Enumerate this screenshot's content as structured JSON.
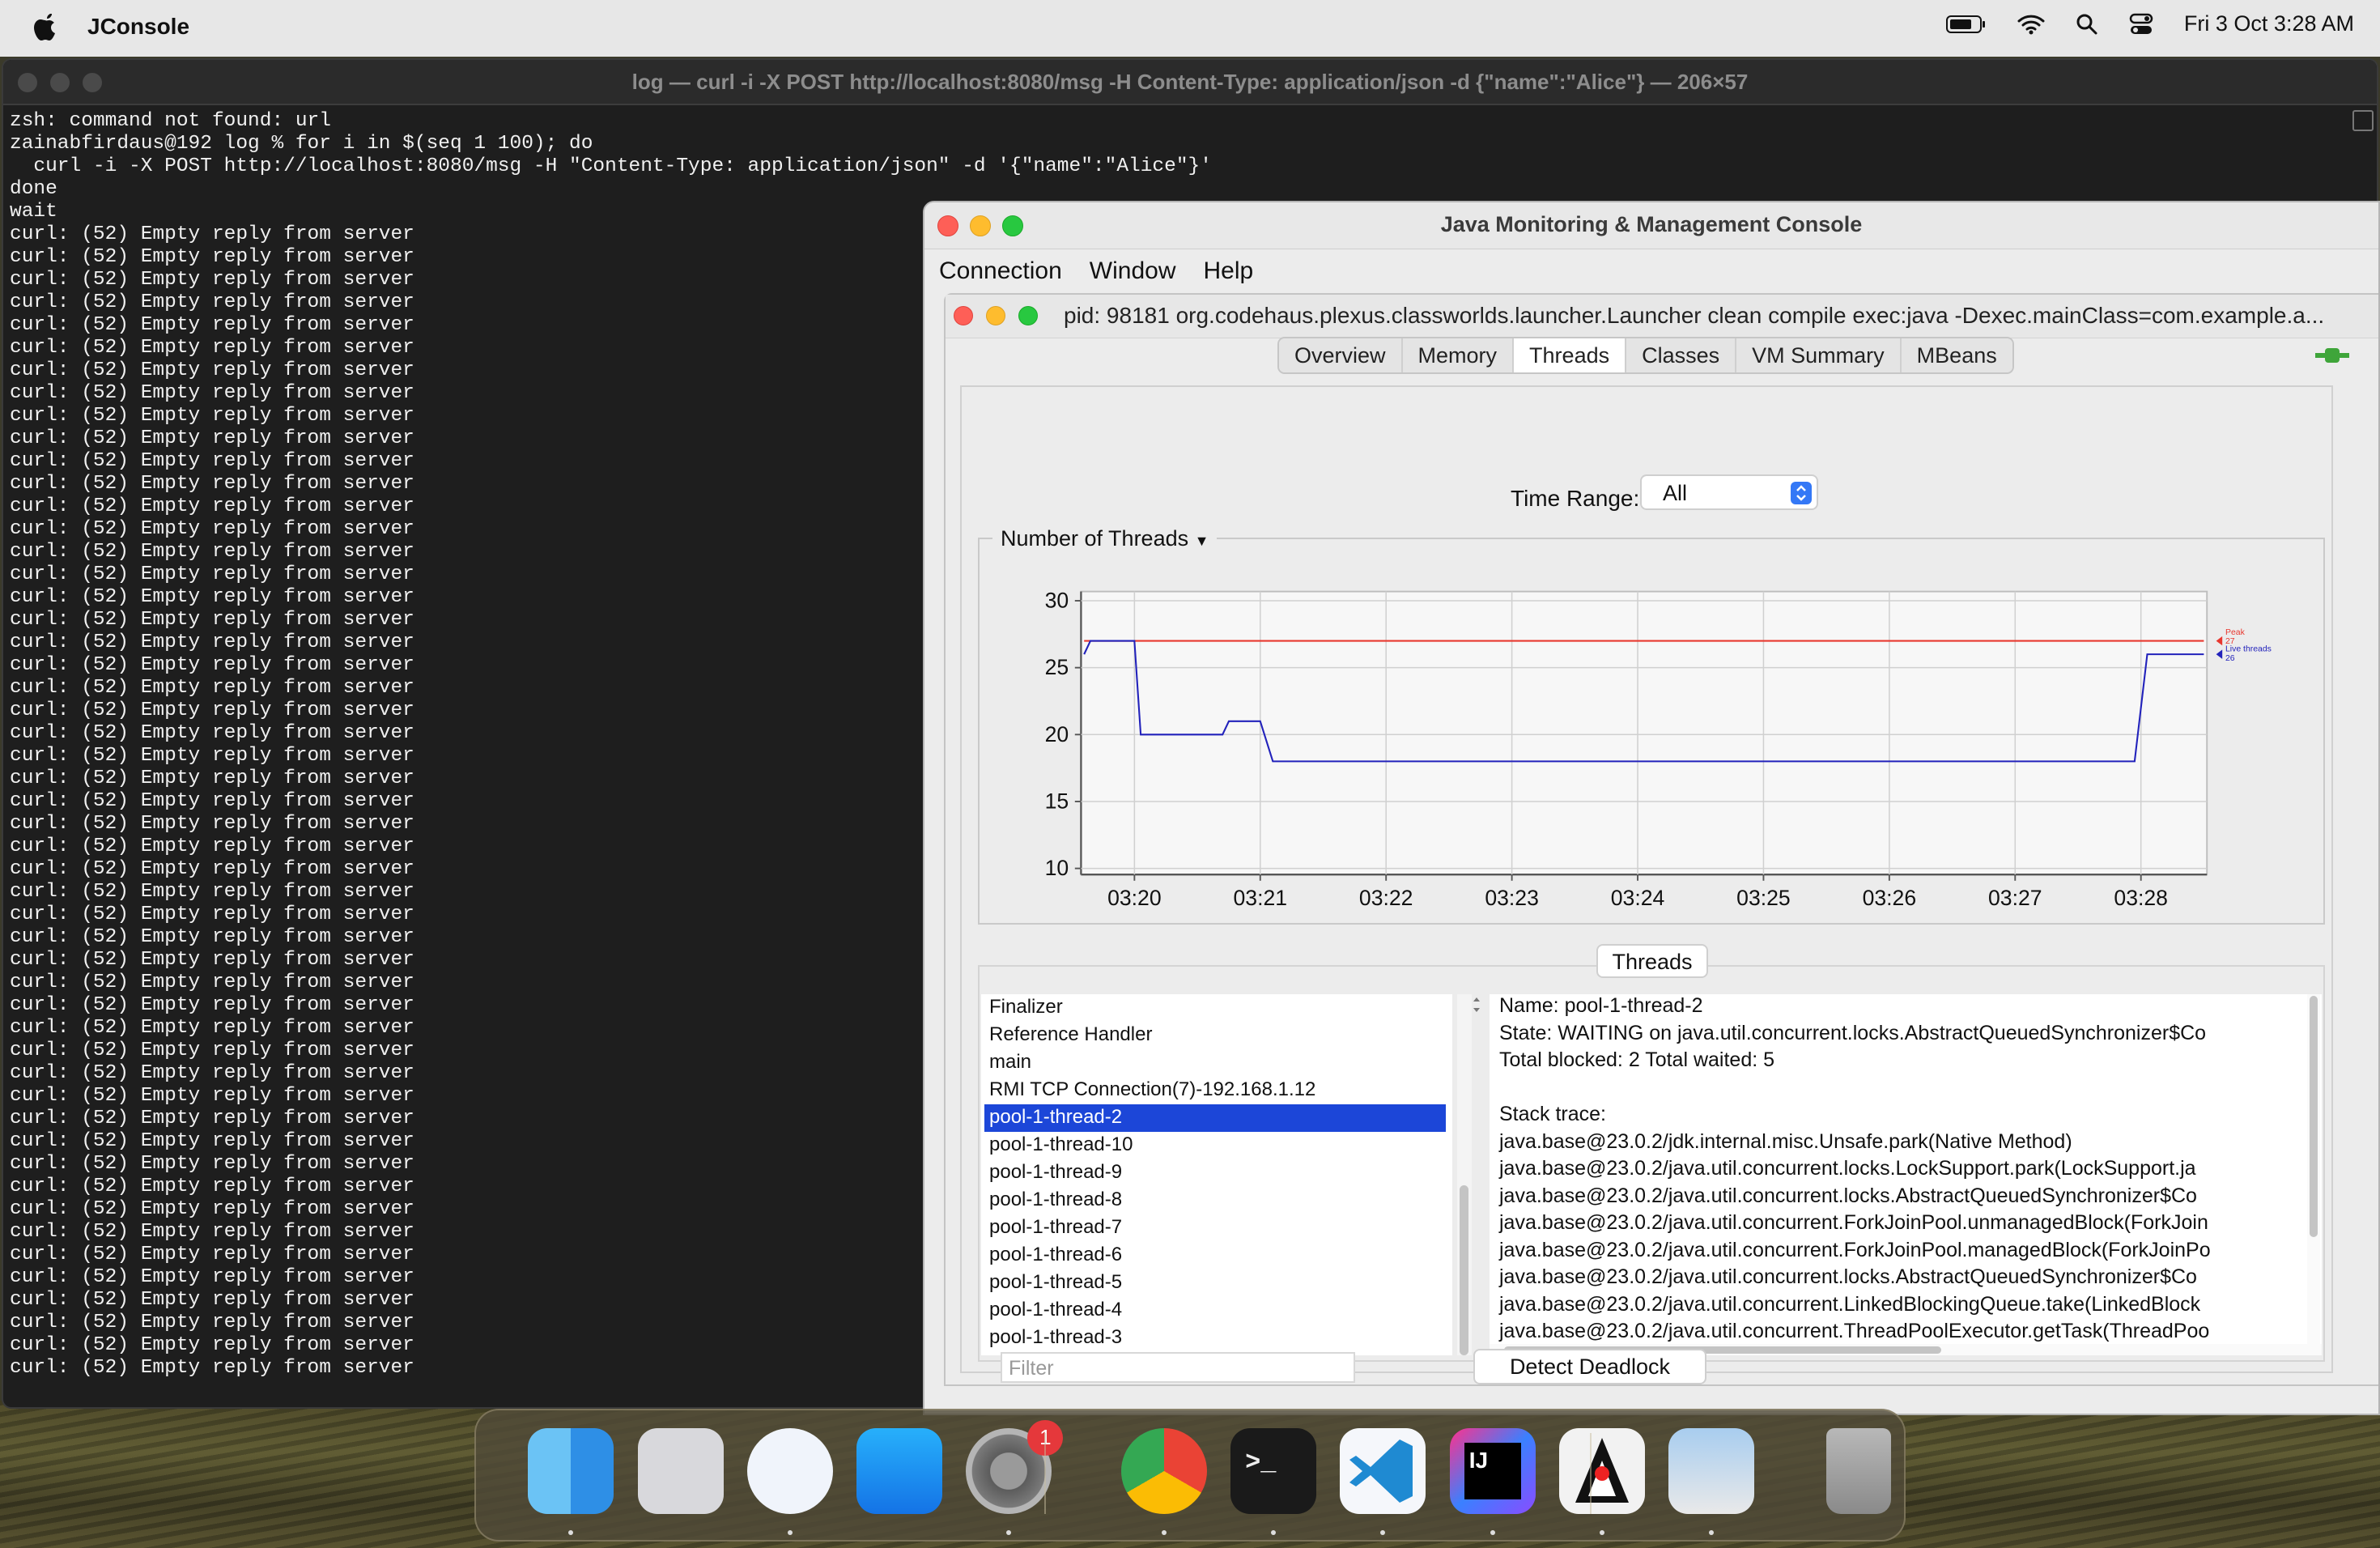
{
  "menubar": {
    "app_name": "JConsole",
    "date_time": "Fri 3 Oct  3:28 AM"
  },
  "terminal": {
    "title": "log — curl -i -X POST http://localhost:8080/msg -H Content-Type: application/json -d {\"name\":\"Alice\"} — 206×57",
    "header_lines": [
      "zsh: command not found: url",
      "zainabfirdaus@192 log % for i in $(seq 1 100); do",
      "  curl -i -X POST http://localhost:8080/msg -H \"Content-Type: application/json\" -d '{\"name\":\"Alice\"}'",
      "done",
      "wait"
    ],
    "repeated_line": "curl: (52) Empty reply from server",
    "repeated_count": 51
  },
  "jconsole": {
    "window_title": "Java Monitoring & Management Console",
    "menu": [
      "Connection",
      "Window",
      "Help"
    ],
    "inner_title": "pid: 98181 org.codehaus.plexus.classworlds.launcher.Launcher clean compile exec:java -Dexec.mainClass=com.example.a...",
    "tabs": [
      "Overview",
      "Memory",
      "Threads",
      "Classes",
      "VM Summary",
      "MBeans"
    ],
    "active_tab": "Threads",
    "time_range_label": "Time Range:",
    "time_range_value": "All",
    "chart_title": "Number of Threads",
    "threads_button": "Threads",
    "thread_list": [
      "Finalizer",
      "Reference Handler",
      "main",
      "RMI TCP Connection(7)-192.168.1.12",
      "pool-1-thread-2",
      "pool-1-thread-10",
      "pool-1-thread-9",
      "pool-1-thread-8",
      "pool-1-thread-7",
      "pool-1-thread-6",
      "pool-1-thread-5",
      "pool-1-thread-4",
      "pool-1-thread-3"
    ],
    "selected_thread": "pool-1-thread-2",
    "detail_lines": [
      "Name: pool-1-thread-2",
      "State: WAITING on java.util.concurrent.locks.AbstractQueuedSynchronizer$Co",
      "Total blocked: 2  Total waited: 5",
      "",
      "Stack trace:",
      "java.base@23.0.2/jdk.internal.misc.Unsafe.park(Native Method)",
      "java.base@23.0.2/java.util.concurrent.locks.LockSupport.park(LockSupport.ja",
      "java.base@23.0.2/java.util.concurrent.locks.AbstractQueuedSynchronizer$Co",
      "java.base@23.0.2/java.util.concurrent.ForkJoinPool.unmanagedBlock(ForkJoin",
      "java.base@23.0.2/java.util.concurrent.ForkJoinPool.managedBlock(ForkJoinPo",
      "java.base@23.0.2/java.util.concurrent.locks.AbstractQueuedSynchronizer$Co",
      "java.base@23.0.2/java.util.concurrent.LinkedBlockingQueue.take(LinkedBlock",
      "java.base@23.0.2/java.util.concurrent.ThreadPoolExecutor.getTask(ThreadPoo"
    ],
    "filter_placeholder": "Filter",
    "detect_deadlock_label": "Detect Deadlock"
  },
  "chart_data": {
    "type": "line",
    "title": "Number of Threads",
    "x_ticks": [
      "03:20",
      "03:21",
      "03:22",
      "03:23",
      "03:24",
      "03:25",
      "03:26",
      "03:27",
      "03:28"
    ],
    "y_ticks": [
      10,
      15,
      20,
      25,
      30
    ],
    "ylim": [
      10,
      30
    ],
    "xlim_minutes": [
      19.6,
      28.5
    ],
    "grid": true,
    "legend_placement": "right",
    "series": [
      {
        "name": "Peak",
        "legend_value": "27",
        "color": "#e8382f",
        "points": [
          [
            19.6,
            27
          ],
          [
            28.5,
            27
          ]
        ]
      },
      {
        "name": "Live threads",
        "legend_value": "26",
        "color": "#2222bb",
        "points": [
          [
            19.6,
            26
          ],
          [
            19.65,
            27
          ],
          [
            20.0,
            27
          ],
          [
            20.05,
            20
          ],
          [
            20.7,
            20
          ],
          [
            20.75,
            21
          ],
          [
            21.0,
            21
          ],
          [
            21.1,
            18
          ],
          [
            27.95,
            18
          ],
          [
            28.05,
            26
          ],
          [
            28.5,
            26
          ]
        ]
      }
    ]
  },
  "dock": {
    "apps": [
      "finder",
      "launchpad",
      "safari",
      "app-store",
      "system-settings",
      "chrome",
      "terminal",
      "vscode",
      "intellij",
      "jconsole",
      "preview",
      "trash"
    ],
    "settings_badge": "1"
  },
  "colors": {
    "selection": "#1c46d8",
    "terminal_bg": "#1e1e1e",
    "peak": "#e8382f",
    "live": "#2222bb"
  }
}
